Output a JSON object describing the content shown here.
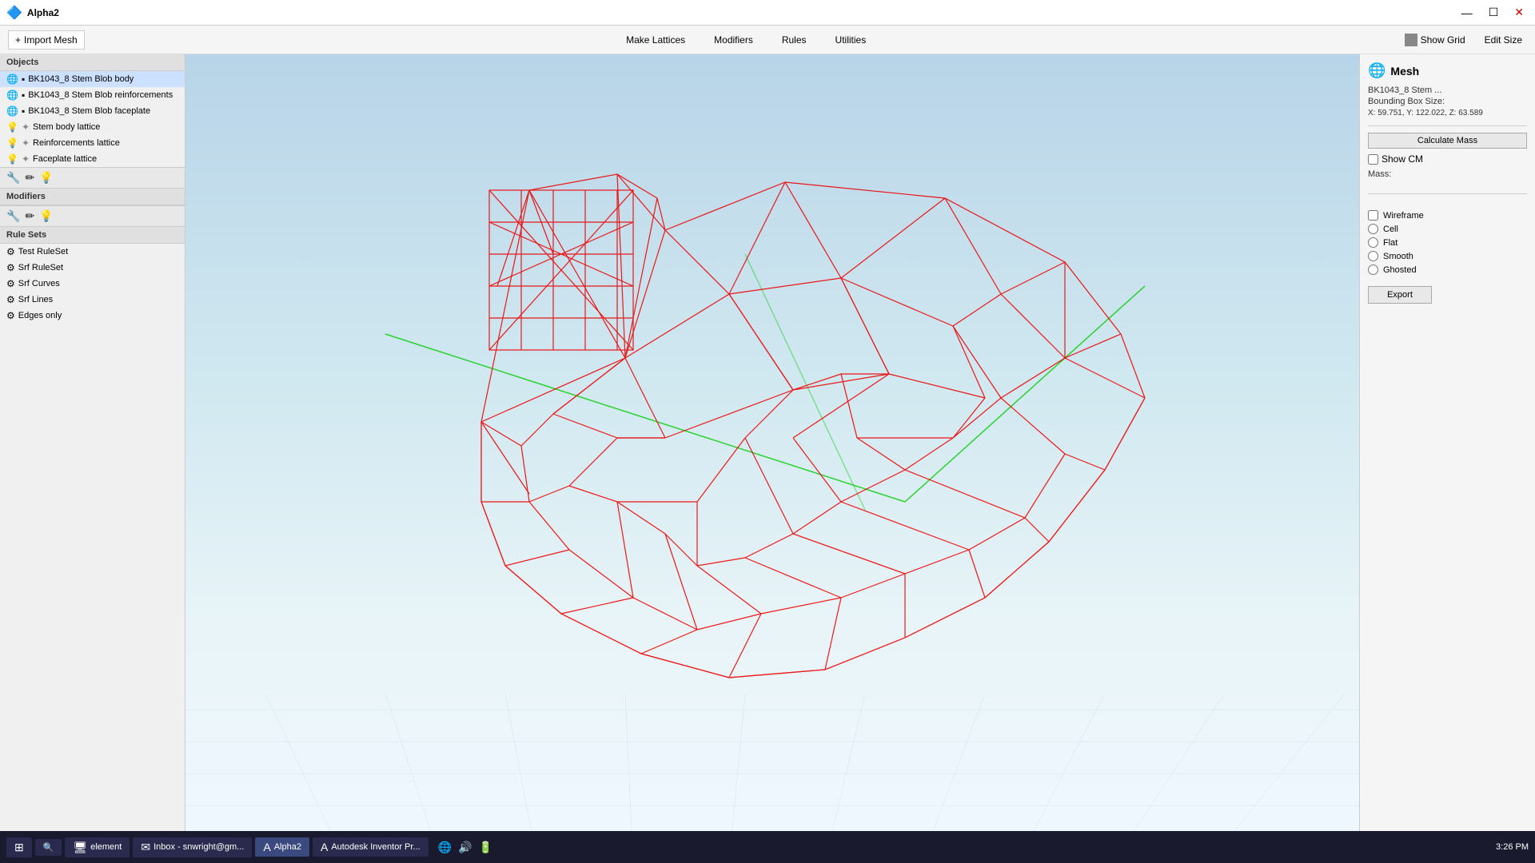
{
  "title_bar": {
    "app_name": "Alpha2",
    "min_label": "—",
    "max_label": "☐",
    "close_label": "✕"
  },
  "menu_bar": {
    "import_label": "Import Mesh",
    "items": [
      "Make Lattices",
      "Modifiers",
      "Rules",
      "Utilities"
    ],
    "show_grid_label": "Show Grid",
    "edit_size_label": "Edit Size"
  },
  "left_panel": {
    "objects_section": "Objects",
    "objects": [
      {
        "label": "BK1043_8 Stem Blob body",
        "icon": "🌐",
        "sub_icon": "⬜",
        "selected": true
      },
      {
        "label": "BK1043_8 Stem Blob reinforcements",
        "icon": "🌐",
        "sub_icon": "⬜"
      },
      {
        "label": "BK1043_8 Stem Blob faceplate",
        "icon": "🌐",
        "sub_icon": "⬜"
      },
      {
        "label": "Stem body lattice",
        "icon": "💡",
        "sub_icon": "✦"
      },
      {
        "label": "Reinforcements lattice",
        "icon": "💡",
        "sub_icon": "✦"
      },
      {
        "label": "Faceplate lattice",
        "icon": "💡",
        "sub_icon": "✦"
      }
    ],
    "modifiers_section": "Modifiers",
    "rule_sets_section": "Rule Sets",
    "rule_sets": [
      {
        "label": "Test RuleSet",
        "icon": "⚙"
      },
      {
        "label": "Srf RuleSet",
        "icon": "⚙"
      },
      {
        "label": "Srf Curves",
        "icon": "⚙"
      },
      {
        "label": "Srf Lines",
        "icon": "⚙"
      },
      {
        "label": "Edges only",
        "icon": "⚙"
      }
    ]
  },
  "right_panel": {
    "section_title": "Mesh",
    "mesh_name": "BK1043_8 Stem ...",
    "bounding_box_label": "Bounding Box Size:",
    "bounding_box_values": "X: 59.751, Y: 122.022, Z: 63.589",
    "calculate_mass_label": "Calculate Mass",
    "show_cm_label": "Show CM",
    "mass_label": "Mass:",
    "render_options": [
      {
        "label": "Wireframe",
        "type": "checkbox",
        "checked": false
      },
      {
        "label": "Cell",
        "type": "radio",
        "checked": false
      },
      {
        "label": "Flat",
        "type": "radio",
        "checked": false
      },
      {
        "label": "Smooth",
        "type": "radio",
        "checked": false
      },
      {
        "label": "Ghosted",
        "type": "radio",
        "checked": false
      }
    ],
    "export_label": "Export"
  },
  "taskbar": {
    "items": [
      {
        "label": "element",
        "icon": "🖥"
      },
      {
        "label": "Inbox - snwright@gm...",
        "icon": "✉"
      },
      {
        "label": "Alpha2",
        "icon": "A"
      },
      {
        "label": "Autodesk Inventor Pr...",
        "icon": "A"
      }
    ],
    "clock": "3:26 PM"
  }
}
